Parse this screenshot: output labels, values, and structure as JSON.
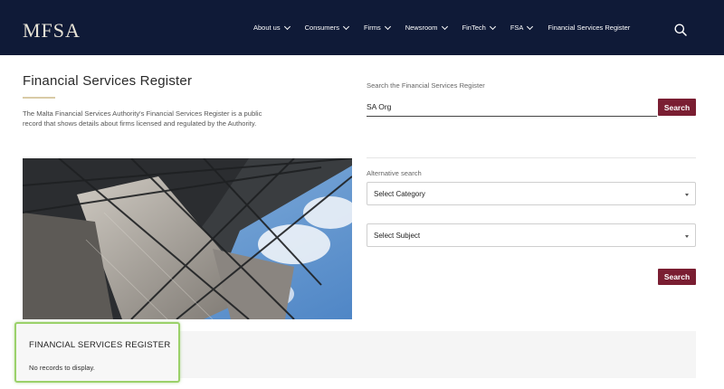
{
  "header": {
    "logo_text": "MFSA",
    "nav": [
      {
        "label": "About us",
        "has_dropdown": true
      },
      {
        "label": "Consumers",
        "has_dropdown": true
      },
      {
        "label": "Firms",
        "has_dropdown": true
      },
      {
        "label": "Newsroom",
        "has_dropdown": true
      },
      {
        "label": "FinTech",
        "has_dropdown": true
      },
      {
        "label": "FSA",
        "has_dropdown": true
      },
      {
        "label": "Financial Services Register",
        "has_dropdown": false
      }
    ],
    "search_icon": "search-icon"
  },
  "page": {
    "title": "Financial Services Register",
    "intro": "The Malta Financial Services Authority's Financial Services Register is a public record that shows details about firms licensed and regulated by the Authority."
  },
  "search": {
    "label": "Search the Financial Services Register",
    "value": "SA Org",
    "button_label": "Search"
  },
  "alternative": {
    "label": "Alternative search",
    "category_value": "Select Category",
    "subject_value": "Select Subject",
    "button_label": "Search"
  },
  "results": {
    "title": "FINANCIAL SERVICES REGISTER",
    "empty_text": "No records to display."
  },
  "colors": {
    "header_bg": "#0f1a37",
    "accent": "#7a1e32",
    "title_rule": "#d9cba6",
    "highlight": "#9bd16a"
  }
}
